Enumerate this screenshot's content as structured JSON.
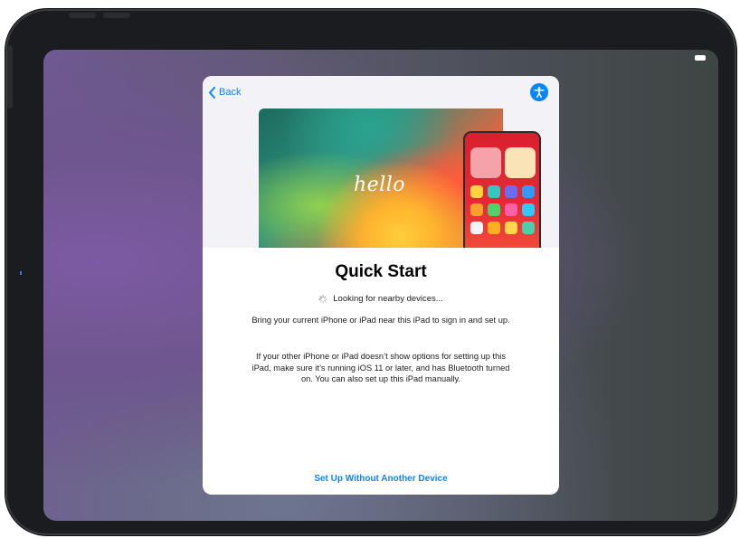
{
  "nav": {
    "back_label": "Back",
    "accessibility_icon": "accessibility-icon"
  },
  "hero": {
    "greeting": "hello"
  },
  "content": {
    "title": "Quick Start",
    "status": "Looking for nearby devices...",
    "paragraph_1": "Bring your current iPhone or iPad near this iPad to sign in and set up.",
    "paragraph_2": "If your other iPhone or iPad doesn’t show options for setting up this iPad, make sure it’s running iOS 11 or later, and has Bluetooth turned on. You can also set up this iPad manually."
  },
  "actions": {
    "setup_without_device": "Set Up Without Another Device"
  },
  "colors": {
    "accent": "#0a84ff",
    "card_background": "#ffffff",
    "card_header_background": "#f2f2f7",
    "device_frame": "#1b1c1f"
  },
  "icons": {
    "back": "chevron-left-icon",
    "spinner": "activity-spinner-icon",
    "battery": "battery-icon"
  }
}
